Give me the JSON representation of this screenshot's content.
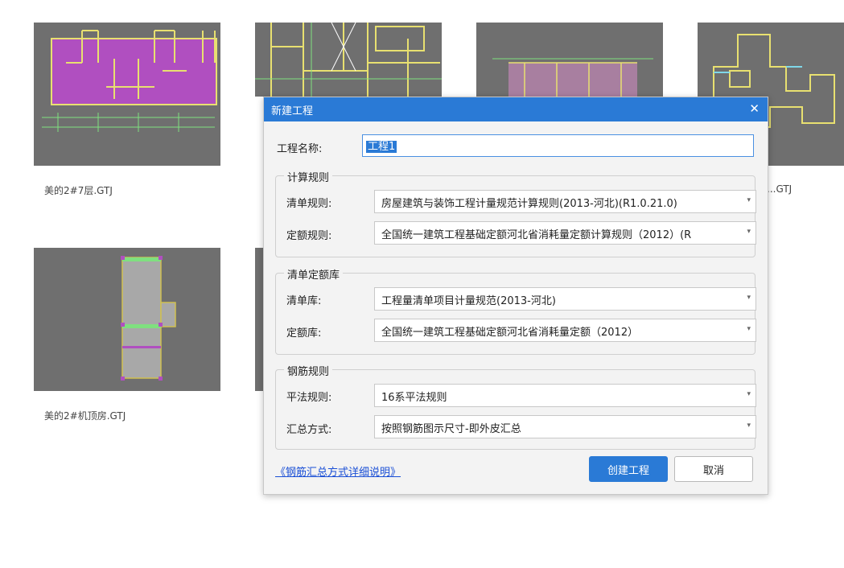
{
  "files": [
    {
      "caption": "美的2#7层.GTJ"
    },
    {
      "caption": "美的2#机顶房.GTJ"
    },
    {
      "caption": "...GTJ"
    }
  ],
  "dialog": {
    "title": "新建工程",
    "close_icon": "close-icon",
    "name_label": "工程名称:",
    "name_value": "工程1",
    "group_calc": {
      "title": "计算规则",
      "list_rule_label": "清单规则:",
      "list_rule_value": "房屋建筑与装饰工程计量规范计算规则(2013-河北)(R1.0.21.0)",
      "quota_rule_label": "定额规则:",
      "quota_rule_value": "全国统一建筑工程基础定额河北省消耗量定额计算规则（2012）(R"
    },
    "group_lib": {
      "title": "清单定额库",
      "list_lib_label": "清单库:",
      "list_lib_value": "工程量清单项目计量规范(2013-河北)",
      "quota_lib_label": "定额库:",
      "quota_lib_value": "全国统一建筑工程基础定额河北省消耗量定额（2012）"
    },
    "group_rebar": {
      "title": "钢筋规则",
      "plan_rule_label": "平法规则:",
      "plan_rule_value": "16系平法规则",
      "summary_label": "汇总方式:",
      "summary_value": "按照钢筋图示尺寸-即外皮汇总"
    },
    "help_link": "《钢筋汇总方式详细说明》",
    "create_button": "创建工程",
    "cancel_button": "取消"
  },
  "colors": {
    "accent": "#2a7ad6",
    "thumb_bg": "#6f6f6f",
    "link": "#1a4fd6"
  }
}
